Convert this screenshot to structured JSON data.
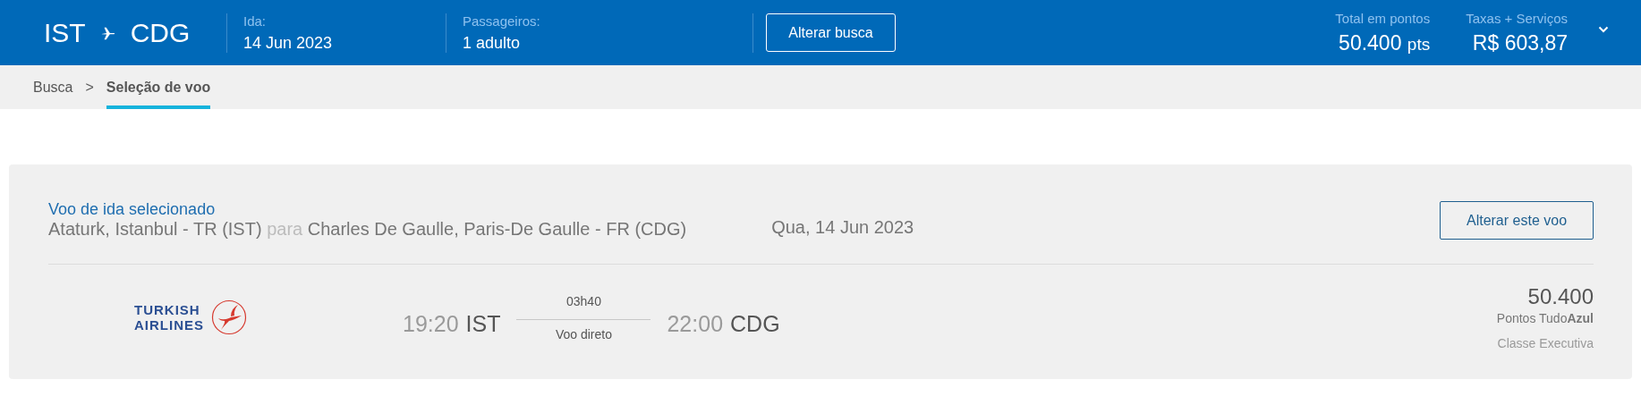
{
  "header": {
    "origin": "IST",
    "destination": "CDG",
    "date_label": "Ida:",
    "date": "14 Jun 2023",
    "passengers_label": "Passageiros:",
    "passengers": "1 adulto",
    "change_search_button": "Alterar busca",
    "points_label": "Total em pontos",
    "points_value": "50.400",
    "points_unit": "pts",
    "fees_label": "Taxas + Serviços",
    "fees_value": "R$ 603,87",
    "expanded": false
  },
  "breadcrumbs": [
    {
      "label": "Busca",
      "selected": false
    },
    {
      "label": "Seleção de voo",
      "selected": true
    }
  ],
  "breadcrumb_separator": ">",
  "selected_flight": {
    "title": "Voo de ida selecionado",
    "from": "Ataturk, Istanbul - TR (IST)",
    "connector": "para",
    "to": "Charles De Gaulle, Paris-De Gaulle - FR (CDG)",
    "date": "Qua, 14 Jun 2023",
    "change_button": "Alterar este voo",
    "airline_logo_lines": [
      "TURKISH",
      "AIRLINES"
    ],
    "departure_time": "19:20",
    "departure_airport": "IST",
    "duration": "03h40",
    "stops": "Voo direto",
    "arrival_time": "22:00",
    "arrival_airport": "CDG",
    "price": "50.400",
    "price_unit": "Pontos Tudo**Azul**",
    "cabin": "Classe Executiva"
  }
}
